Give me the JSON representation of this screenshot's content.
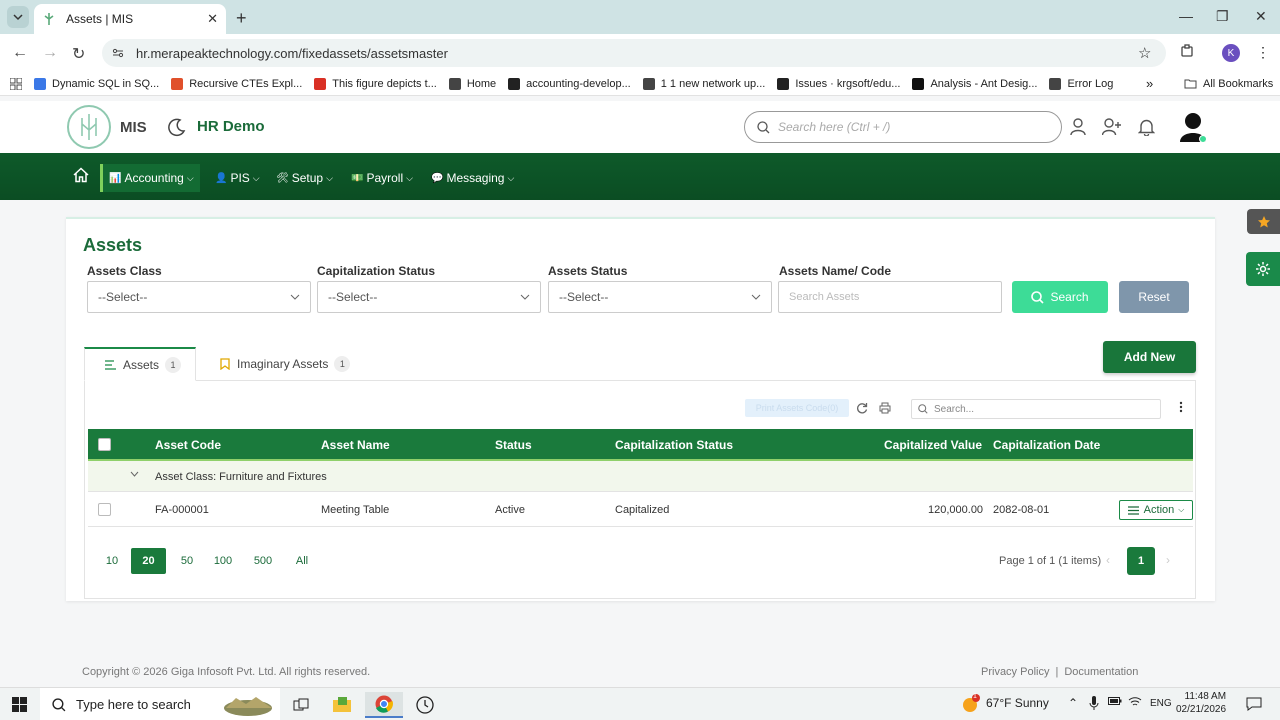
{
  "browser": {
    "tab_title": "Assets | MIS",
    "url": "hr.merapeaktechnology.com/fixedassets/assetsmaster",
    "profile_initial": "K",
    "bookmarks": [
      {
        "label": "Dynamic SQL in SQ...",
        "color": "#3b78e7"
      },
      {
        "label": "Recursive CTEs Expl...",
        "color": "#e0502b"
      },
      {
        "label": "This figure depicts t...",
        "color": "#d93025"
      },
      {
        "label": "Home",
        "color": "#444444"
      },
      {
        "label": "accounting-develop...",
        "color": "#222222"
      },
      {
        "label": "1 1 new network up...",
        "color": "#444444"
      },
      {
        "label": "Issues · krgsoft/edu...",
        "color": "#222222"
      },
      {
        "label": "Analysis - Ant Desig...",
        "color": "#111111"
      },
      {
        "label": "Error Log",
        "color": "#444444"
      }
    ],
    "all_bookmarks": "All Bookmarks"
  },
  "app": {
    "name": "MIS",
    "org": "HR Demo",
    "search_placeholder": "Search here (Ctrl + /)"
  },
  "nav": {
    "items": [
      {
        "label": "Accounting",
        "icon": "📊"
      },
      {
        "label": "PIS",
        "icon": "👤"
      },
      {
        "label": "Setup",
        "icon": "🛠"
      },
      {
        "label": "Payroll",
        "icon": "💵"
      },
      {
        "label": "Messaging",
        "icon": "💬"
      }
    ]
  },
  "page": {
    "title": "Assets",
    "filters": {
      "assets_class_label": "Assets Class",
      "assets_class_value": "--Select--",
      "cap_status_label": "Capitalization Status",
      "cap_status_value": "--Select--",
      "assets_status_label": "Assets Status",
      "assets_status_value": "--Select--",
      "name_code_label": "Assets Name/ Code",
      "name_code_placeholder": "Search Assets"
    },
    "search_button": "Search",
    "reset_button": "Reset",
    "add_new_button": "Add New",
    "tabs": [
      {
        "label": "Assets",
        "count": "1"
      },
      {
        "label": "Imaginary Assets",
        "count": "1"
      }
    ],
    "toolbar": {
      "print_button": "Print Assets Code(0)",
      "search_placeholder": "Search..."
    },
    "table": {
      "columns": [
        "Asset Code",
        "Asset Name",
        "Status",
        "Capitalization Status",
        "Capitalized Value",
        "Capitalization Date"
      ],
      "group_label": "Asset Class: Furniture and Fixtures",
      "rows": [
        {
          "code": "FA-000001",
          "name": "Meeting Table",
          "status": "Active",
          "cap_status": "Capitalized",
          "cap_value": "120,000.00",
          "cap_date": "2082-08-01",
          "action": "Action"
        }
      ]
    },
    "pager": {
      "sizes": [
        "10",
        "20",
        "50",
        "100",
        "500",
        "All"
      ],
      "selected_size": "20",
      "info": "Page 1 of 1 (1 items)",
      "current_page": "1"
    }
  },
  "footer": {
    "copyright": "Copyright © 2026 Giga Infosoft Pvt. Ltd. All rights reserved.",
    "privacy": "Privacy Policy",
    "separator": "|",
    "docs": "Documentation"
  },
  "taskbar": {
    "search_placeholder": "Type here to search",
    "weather": "67°F  Sunny",
    "lang": "ENG",
    "time": "11:48 AM",
    "date": "02/21/2026",
    "weather_badge": "1"
  },
  "colors": {
    "brand_green": "#1a7a3c",
    "nav_green": "#0e5a2a",
    "search_button": "#3ddc97",
    "reset_button": "#7f96ab"
  }
}
